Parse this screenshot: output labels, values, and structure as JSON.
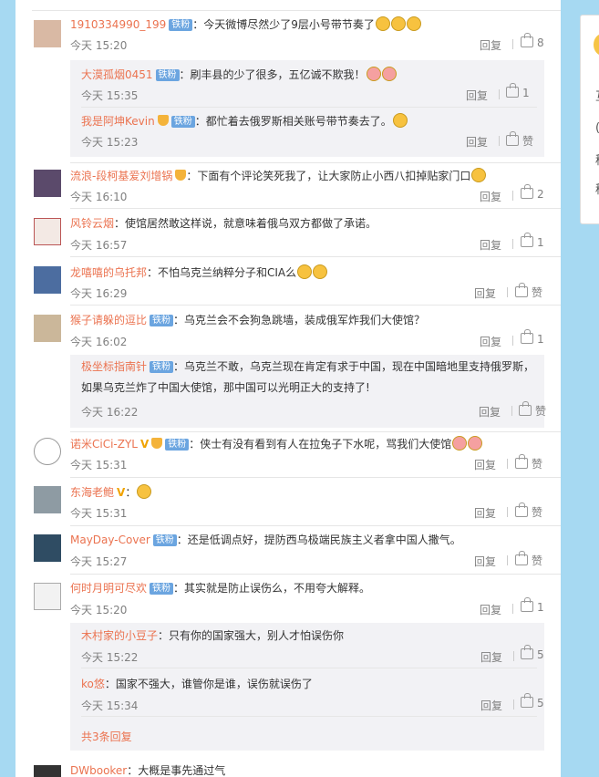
{
  "ui": {
    "reply_label": "回复",
    "like_label": "赞"
  },
  "side": {
    "glyph1": "互",
    "glyph2": "(",
    "glyph3": "稿",
    "glyph4": "稿"
  },
  "comments": [
    {
      "user": "1910334990_199",
      "badge": "铁粉",
      "text": "：今天微博尽然少了9层小号带节奏了",
      "time": "今天 15:20",
      "likes": "8",
      "replies": [
        {
          "user": "大漠孤烟0451",
          "badge": "铁粉",
          "text": "：刷丰县的少了很多，五亿诚不欺我！",
          "time": "今天 15:35",
          "likes": "1"
        },
        {
          "user": "我是阿坤Kevin",
          "badge": "铁粉",
          "text": "：都忙着去俄罗斯相关账号带节奏去了。",
          "time": "今天 15:23",
          "likes": "赞"
        }
      ]
    },
    {
      "user": "流浪-段柯基爱刘增锅",
      "text": "：下面有个评论笑死我了，让大家防止小西八扣掉贴家门口",
      "time": "今天 16:10",
      "likes": "2"
    },
    {
      "user": "风铃云烟",
      "text": "：使馆居然敢这样说，就意味着俄乌双方都做了承诺。",
      "time": "今天 16:57",
      "likes": "1"
    },
    {
      "user": "龙嘻嘻的乌托邦",
      "text": "：不怕乌克兰纳粹分子和CIA么",
      "time": "今天 16:29",
      "likes": "赞"
    },
    {
      "user": "猴子请躲的逗比",
      "badge": "铁粉",
      "text": "：乌克兰会不会狗急跳墙，装成俄军炸我们大使馆？",
      "time": "今天 16:02",
      "likes": "1",
      "replies": [
        {
          "user": "极坐标指南针",
          "badge": "铁粉",
          "text": "：乌克兰不敢，乌克兰现在肯定有求于中国，现在中国暗地里支持俄罗斯，如果乌克兰炸了中国大使馆，那中国可以光明正大的支持了!",
          "time": "今天 16:22",
          "likes": "赞"
        }
      ]
    },
    {
      "user": "诺米CiCi-ZYL",
      "badge": "铁粉",
      "text": "：侠士有没有看到有人在拉兔子下水呢，骂我们大使馆",
      "time": "今天 15:31",
      "likes": "赞"
    },
    {
      "user": "东海老鲍",
      "text": "：",
      "time": "今天 15:31",
      "likes": "赞"
    },
    {
      "user": "MayDay-Cover",
      "badge": "铁粉",
      "text": "：还是低调点好，提防西乌极端民族主义者拿中国人撒气。",
      "time": "今天 15:27",
      "likes": "赞"
    },
    {
      "user": "何时月明可尽欢",
      "badge": "铁粉",
      "text": "：其实就是防止误伤么，不用夸大解释。",
      "time": "今天 15:20",
      "likes": "1",
      "replies": [
        {
          "user": "木村家的小豆子",
          "text": "：只有你的国家强大，别人才怕误伤你",
          "time": "今天 15:22",
          "likes": "5"
        },
        {
          "user": "ko悠",
          "text": "：国家不强大，谁管你是谁，误伤就误伤了",
          "time": "今天 15:34",
          "likes": "5"
        }
      ],
      "more": "共3条回复"
    },
    {
      "user": "DWbooker",
      "text": "：大概是事先通过气"
    }
  ]
}
